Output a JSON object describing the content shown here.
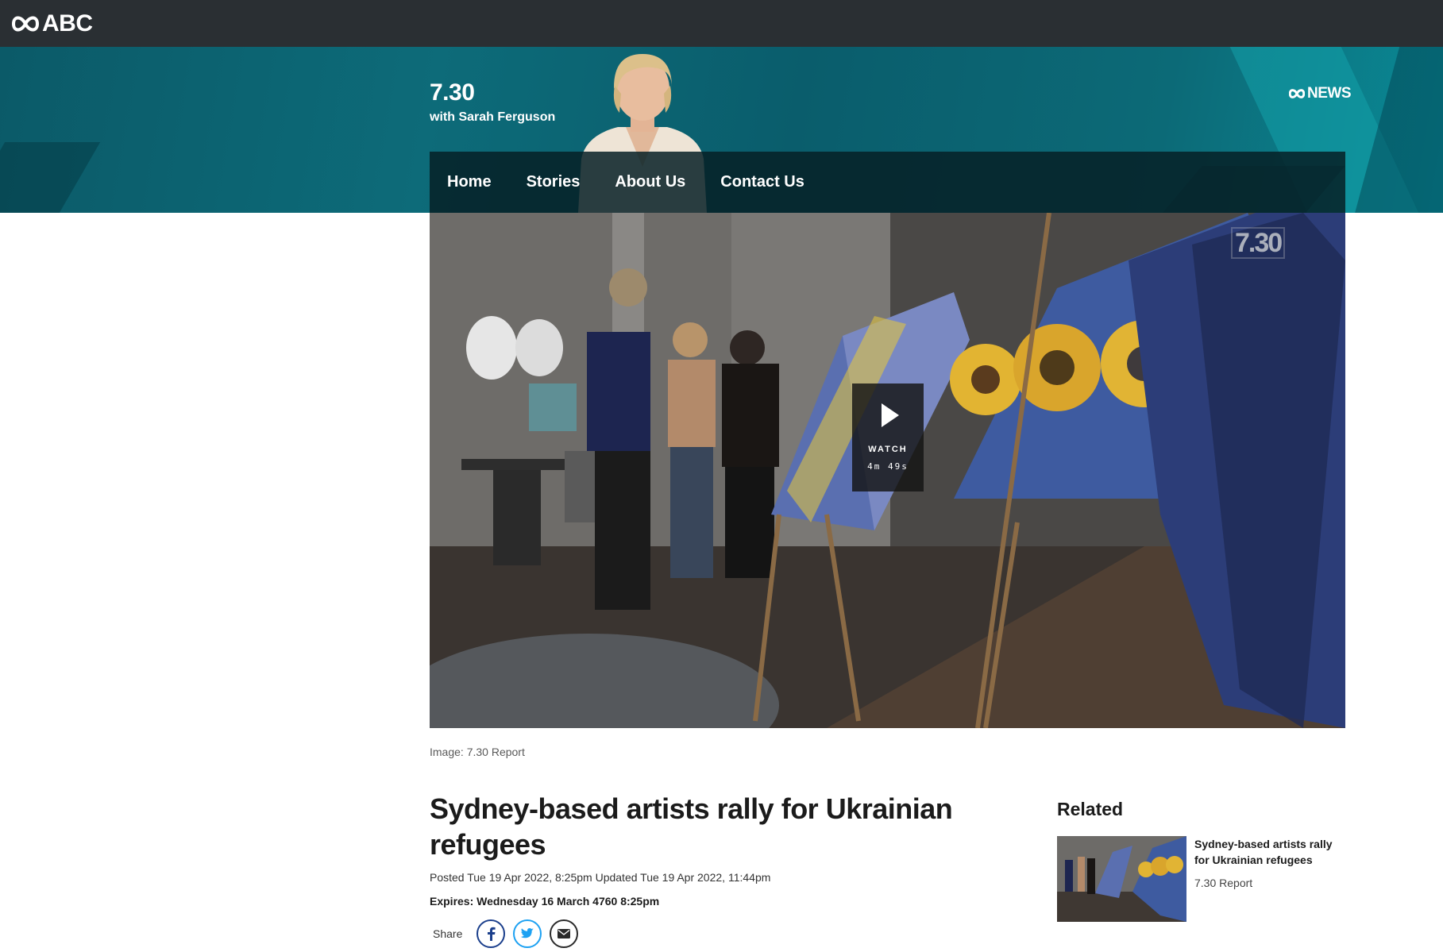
{
  "top_bar": {
    "brand": "ABC"
  },
  "banner": {
    "program_title": "7.30",
    "program_subtitle": "with Sarah Ferguson",
    "network": "NEWS"
  },
  "nav": {
    "items": [
      {
        "label": "Home"
      },
      {
        "label": "Stories"
      },
      {
        "label": "About Us"
      },
      {
        "label": "Contact Us"
      }
    ]
  },
  "hero": {
    "watch_label": "WATCH",
    "duration": "4m 49s",
    "bug": "7.30",
    "caption": "Image: 7.30 Report"
  },
  "article": {
    "headline": "Sydney-based artists rally for Ukrainian refugees",
    "dates": "Posted Tue 19 Apr 2022, 8:25pm  Updated Tue 19 Apr 2022, 11:44pm",
    "expires": "Expires: Wednesday  16 March 4760 8:25pm",
    "share_label": "Share"
  },
  "related": {
    "title": "Related",
    "items": [
      {
        "headline": "Sydney-based artists rally for Ukrainian refugees",
        "source": "7.30 Report"
      }
    ]
  },
  "colors": {
    "top_bar": "#2a2f33",
    "banner_teal": "#0d6b79",
    "facebook": "#1b3f8c",
    "twitter": "#1da1f2"
  }
}
